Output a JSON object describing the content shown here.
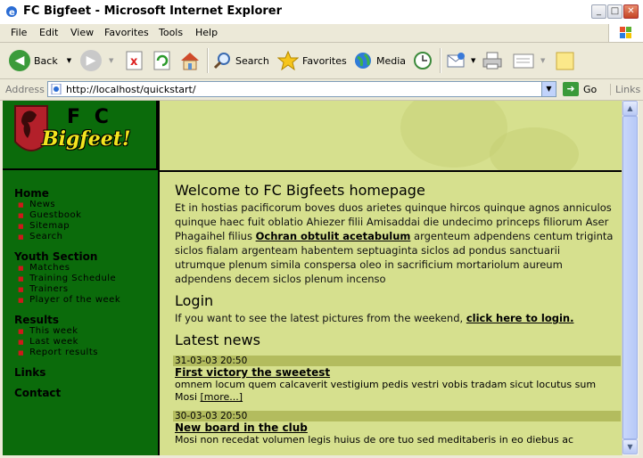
{
  "window": {
    "title": "FC Bigfeet - Microsoft Internet Explorer"
  },
  "menu": [
    "File",
    "Edit",
    "View",
    "Favorites",
    "Tools",
    "Help"
  ],
  "toolbar": {
    "back": "Back",
    "search": "Search",
    "favorites": "Favorites",
    "media": "Media"
  },
  "address": {
    "label": "Address",
    "url": "http://localhost/quickstart/",
    "go": "Go",
    "links": "Links"
  },
  "logo": {
    "line1": "F C",
    "line2": "Bigfeet!"
  },
  "nav": [
    {
      "heading": "Home",
      "items": [
        "News",
        "Guestbook",
        "Sitemap",
        "Search"
      ]
    },
    {
      "heading": "Youth Section",
      "items": [
        "Matches",
        "Training Schedule",
        "Trainers",
        "Player of the week"
      ]
    },
    {
      "heading": "Results",
      "items": [
        "This week",
        "Last week",
        "Report results"
      ]
    },
    {
      "heading": "Links",
      "items": []
    },
    {
      "heading": "Contact",
      "items": []
    }
  ],
  "main": {
    "welcome_title": "Welcome to FC Bigfeets homepage",
    "welcome_text_before": "Et in hostias pacificorum boves duos arietes quinque hircos quinque agnos anniculos quinque haec fuit oblatio Ahiezer filii Amisaddai die undecimo princeps filiorum Aser Phagaihel filius ",
    "welcome_link": "Ochran obtulit acetabulum",
    "welcome_text_after": " argenteum adpendens centum triginta siclos fialam argenteam habentem septuaginta siclos ad pondus sanctuarii utrumque plenum simila conspersa oleo in sacrificium mortariolum aureum adpendens decem siclos plenum incenso",
    "login_title": "Login",
    "login_text": "If you want to see the latest pictures from the weekend, ",
    "login_link": "click here to login.",
    "news_title": "Latest news",
    "news": [
      {
        "date": "31-03-03 20:50",
        "title": "First victory the sweetest",
        "body": "omnem locum quem calcaverit vestigium pedis vestri vobis tradam sicut locutus sum Mosi ",
        "more": "[more...]"
      },
      {
        "date": "30-03-03 20:50",
        "title": "New board in the club",
        "body": "Mosi non recedat volumen legis huius de ore tuo sed meditaberis in eo diebus ac"
      }
    ]
  },
  "colors": {
    "sidebar": "#0b6b0b",
    "content_bg": "#d6e08e",
    "news_bar": "#b3bc5e",
    "bullet": "#cc1a1a"
  }
}
